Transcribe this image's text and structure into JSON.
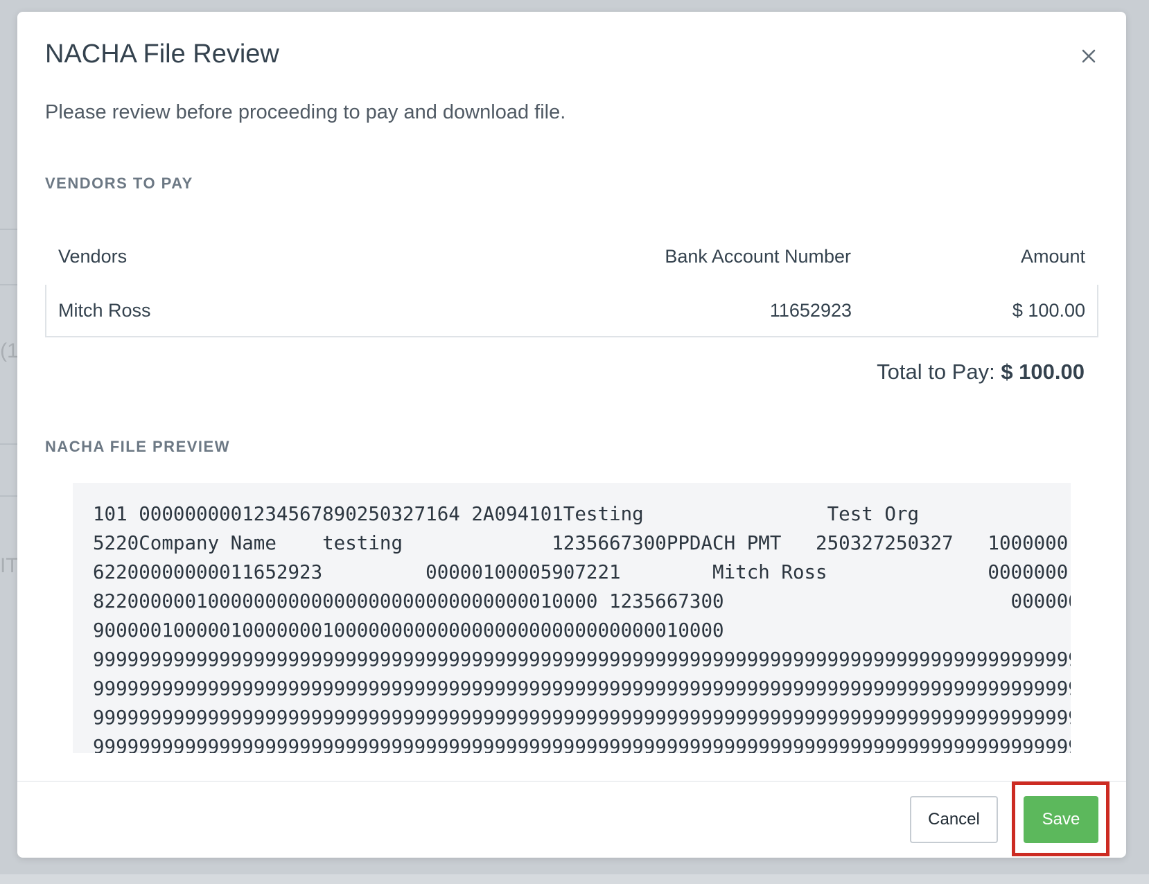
{
  "modal": {
    "title": "NACHA File Review",
    "intro": "Please review before proceeding to pay and download file."
  },
  "vendors_section": {
    "heading": "VENDORS TO PAY",
    "columns": [
      "Vendors",
      "Bank Account Number",
      "Amount"
    ],
    "rows": [
      {
        "vendor": "Mitch Ross",
        "bank_account": "11652923",
        "amount": "$ 100.00"
      }
    ],
    "total_label": "Total to Pay:",
    "total_amount": "$ 100.00"
  },
  "nacha_section": {
    "heading": "NACHA FILE PREVIEW",
    "lines": [
      "101 0000000001234567890250327164 2A094101Testing                Test Org",
      "5220Company Name    testing             1235667300PPDACH PMT   250327250327   1000000",
      "62200000000011652923         00000100005907221        Mitch Ross              0000000",
      "82200000010000000000000000000000000000010000 1235667300                         000000",
      "9000001000001000000010000000000000000000000000000010000",
      "99999999999999999999999999999999999999999999999999999999999999999999999999999999999999",
      "99999999999999999999999999999999999999999999999999999999999999999999999999999999999999",
      "99999999999999999999999999999999999999999999999999999999999999999999999999999999999999",
      "99999999999999999999999999999999999999999999999999999999999999999999999999999999999999"
    ]
  },
  "footer": {
    "cancel_label": "Cancel",
    "save_label": "Save"
  },
  "background": {
    "fragment_1": "(1)",
    "fragment_2": "IT"
  },
  "colors": {
    "save_button": "#5cb85c",
    "highlight_border": "#cc2b22"
  },
  "icons": {
    "close": "close-icon"
  }
}
